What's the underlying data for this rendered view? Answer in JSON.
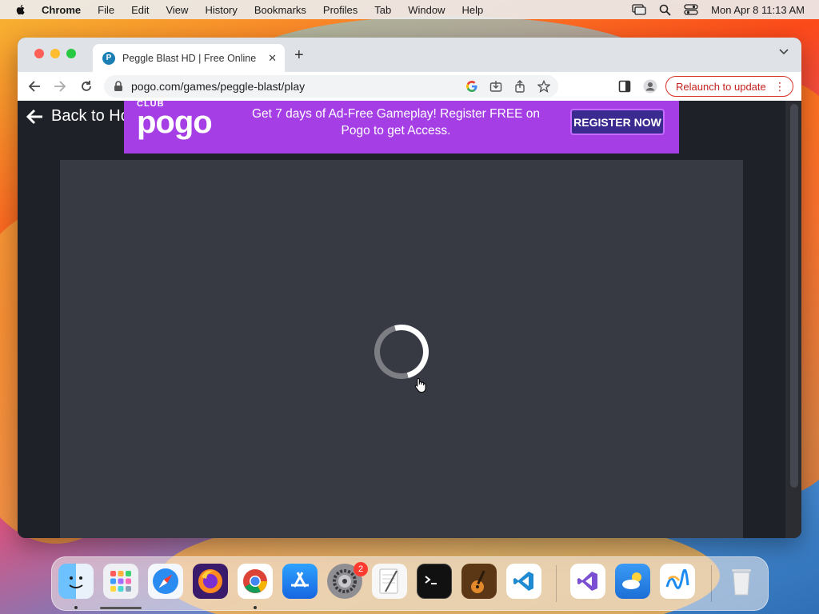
{
  "menubar": {
    "app": "Chrome",
    "items": [
      "File",
      "Edit",
      "View",
      "History",
      "Bookmarks",
      "Profiles",
      "Tab",
      "Window",
      "Help"
    ],
    "datetime": "Mon Apr 8  11:13 AM"
  },
  "browser": {
    "tab": {
      "title": "Peggle Blast HD | Free Online Game",
      "favicon_letter": "P"
    },
    "url": "pogo.com/games/peggle-blast/play",
    "relaunch_label": "Relaunch to update"
  },
  "page": {
    "back_label": "Back to Home",
    "banner": {
      "logo_small": "CLUB",
      "logo_big": "pogo",
      "message": "Get 7 days of Ad-Free Gameplay! Register FREE on Pogo to get Access.",
      "button": "REGISTER NOW"
    },
    "loading": true
  },
  "dock": {
    "apps": [
      {
        "name": "Finder",
        "icon": "finder-icon",
        "color": "#3a8ef0"
      },
      {
        "name": "Launchpad",
        "icon": "launchpad-icon",
        "color": "#e8e8ee"
      },
      {
        "name": "Safari",
        "icon": "safari-icon",
        "color": "#2a8cf0"
      },
      {
        "name": "Firefox",
        "icon": "firefox-icon",
        "color": "#7a2cc9"
      },
      {
        "name": "Chrome",
        "icon": "chrome-icon",
        "color": "#ffffff"
      },
      {
        "name": "App Store",
        "icon": "app-store-icon",
        "color": "#1b8cf5"
      },
      {
        "name": "System Settings",
        "icon": "settings-icon",
        "color": "#8d8d92",
        "badge": "2"
      },
      {
        "name": "TextEdit",
        "icon": "textedit-icon",
        "color": "#f4f4f4"
      },
      {
        "name": "Terminal",
        "icon": "terminal-icon",
        "color": "#111111"
      },
      {
        "name": "GarageBand",
        "icon": "garageband-icon",
        "color": "#4a2a12"
      },
      {
        "name": "Visual Studio Code",
        "icon": "vscode-icon",
        "color": "#ffffff"
      },
      {
        "name": "Visual Studio",
        "icon": "visual-studio-icon",
        "color": "#ffffff"
      },
      {
        "name": "Weather",
        "icon": "weather-icon",
        "color": "#2f8ff0"
      },
      {
        "name": "Freeform",
        "icon": "freeform-icon",
        "color": "#ffffff"
      },
      {
        "name": "Trash",
        "icon": "trash-icon",
        "color": "#e8eaec"
      }
    ]
  }
}
